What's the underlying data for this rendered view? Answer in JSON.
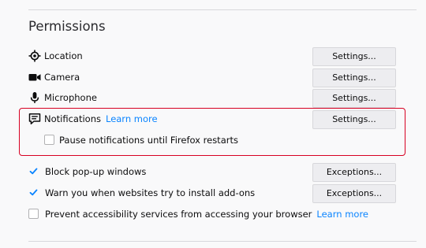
{
  "section": {
    "title": "Permissions"
  },
  "permissions": [
    {
      "label": "Location",
      "icon": "location-icon",
      "button": "Settings..."
    },
    {
      "label": "Camera",
      "icon": "camera-icon",
      "button": "Settings..."
    },
    {
      "label": "Microphone",
      "icon": "microphone-icon",
      "button": "Settings..."
    },
    {
      "label": "Notifications",
      "icon": "notifications-icon",
      "button": "Settings...",
      "learn_more": "Learn more"
    }
  ],
  "pause_notifications": {
    "label": "Pause notifications until Firefox restarts",
    "checked": false
  },
  "block_popups": {
    "label": "Block pop-up windows",
    "checked": true,
    "button": "Exceptions..."
  },
  "warn_addons": {
    "label": "Warn you when websites try to install add-ons",
    "checked": true,
    "button": "Exceptions..."
  },
  "accessibility": {
    "label": "Prevent accessibility services from accessing your browser",
    "checked": false,
    "learn_more": "Learn more"
  },
  "colors": {
    "link": "#0a84ff",
    "checkbox_checked": "#0a84ff",
    "highlight": "#d70022"
  }
}
